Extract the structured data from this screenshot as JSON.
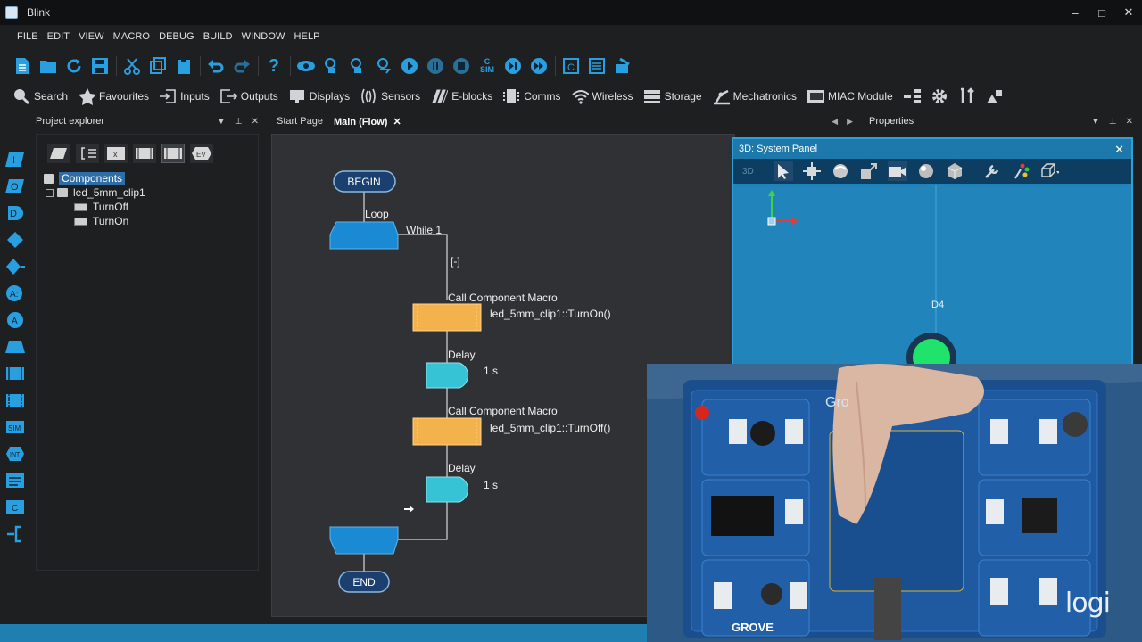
{
  "window": {
    "title": "Blink",
    "controls": [
      "–",
      "□",
      "✕"
    ]
  },
  "menu": [
    "FILE",
    "EDIT",
    "VIEW",
    "MACRO",
    "DEBUG",
    "BUILD",
    "WINDOW",
    "HELP"
  ],
  "component_toolbar": [
    {
      "label": "Search",
      "icon": "search-icon"
    },
    {
      "label": "Favourites",
      "icon": "star-icon"
    },
    {
      "label": "Inputs",
      "icon": "inputs-icon"
    },
    {
      "label": "Outputs",
      "icon": "outputs-icon"
    },
    {
      "label": "Displays",
      "icon": "displays-icon"
    },
    {
      "label": "Sensors",
      "icon": "sensors-icon"
    },
    {
      "label": "E-blocks",
      "icon": "eblocks-icon"
    },
    {
      "label": "Comms",
      "icon": "comms-icon"
    },
    {
      "label": "Wireless",
      "icon": "wireless-icon"
    },
    {
      "label": "Storage",
      "icon": "storage-icon"
    },
    {
      "label": "Mechatronics",
      "icon": "mechatronics-icon"
    },
    {
      "label": "MIAC Module",
      "icon": "miac-icon"
    }
  ],
  "project_explorer": {
    "title": "Project explorer",
    "tree": {
      "root": "Components",
      "component": "led_5mm_clip1",
      "macros": [
        "TurnOff",
        "TurnOn"
      ]
    }
  },
  "tabs": {
    "start": "Start Page",
    "main": "Main (Flow)",
    "close": "✕"
  },
  "properties": {
    "title": "Properties"
  },
  "flow": {
    "begin": "BEGIN",
    "end": "END",
    "loop_label": "Loop",
    "while_label": "While 1",
    "collapse_label": "[-]",
    "call1": {
      "title": "Call Component Macro",
      "text": "led_5mm_clip1::TurnOn()"
    },
    "delay1": {
      "title": "Delay",
      "value": "1 s"
    },
    "call2": {
      "title": "Call Component Macro",
      "text": "led_5mm_clip1::TurnOff()"
    },
    "delay2": {
      "title": "Delay",
      "value": "1 s"
    }
  },
  "system_panel": {
    "title": "3D: System Panel",
    "mode": "3D",
    "pin_label": "D4",
    "close": "✕"
  },
  "webcam": {
    "brand": "logi"
  },
  "colors": {
    "accent": "#2ea0d8",
    "flow_block": "#1a8ad4",
    "call_block": "#f4b24c",
    "delay_block": "#36c3d6",
    "led_on": "#1fe36a"
  }
}
